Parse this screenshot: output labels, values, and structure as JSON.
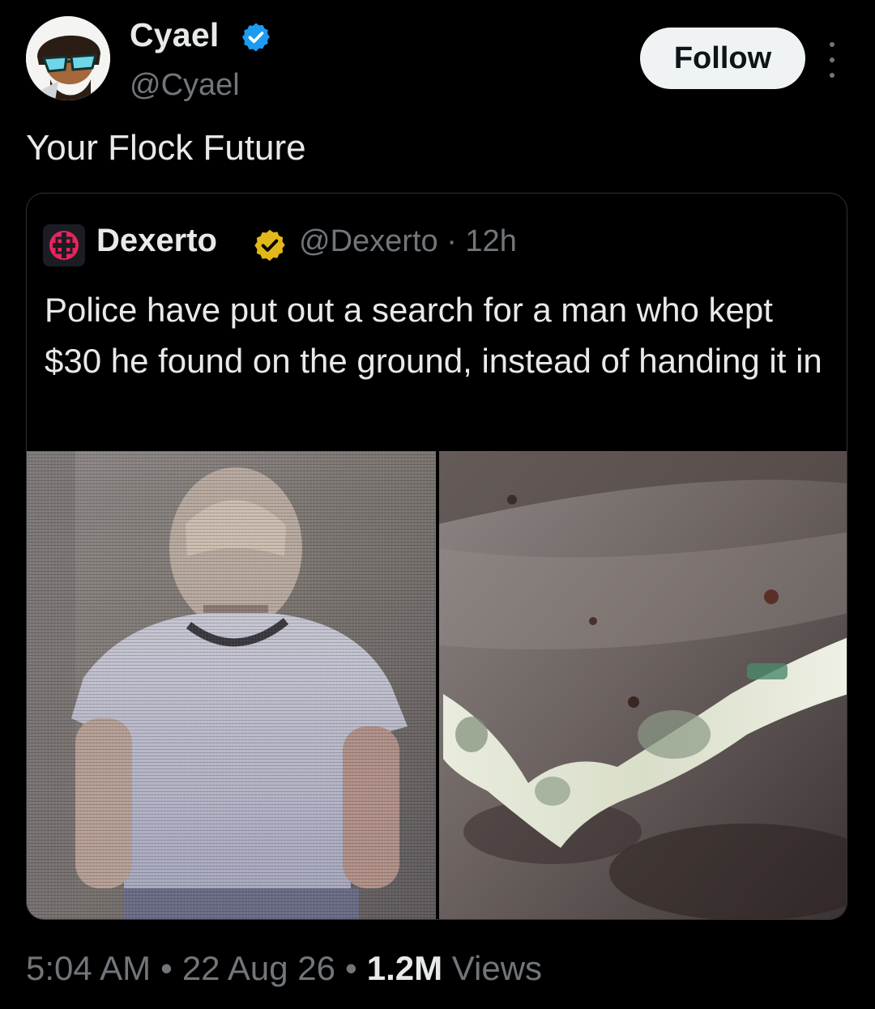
{
  "author": {
    "name": "Cyael",
    "handle": "@Cyael",
    "verified": true,
    "avatar_icon": "cartoon-man-sunglasses-avatar"
  },
  "actions": {
    "follow_label": "Follow",
    "more_icon": "vertical-ellipsis-icon"
  },
  "tweet": {
    "text": "Your Flock Future"
  },
  "quoted": {
    "name": "Dexerto",
    "handle": "@Dexerto",
    "separator": "·",
    "time": "12h",
    "verified": "gold",
    "avatar_icon": "dexerto-logo",
    "text": "Police have put out a search for a man who kept $30 he found on the ground, instead of handing it in",
    "media": [
      {
        "name": "cctv-man-photo"
      },
      {
        "name": "dollar-bill-on-wet-ground-photo"
      }
    ]
  },
  "footer": {
    "time": "5:04 AM",
    "date": "22 Aug 26",
    "views_count": "1.2M",
    "views_label": "Views",
    "separator": "•"
  },
  "colors": {
    "background": "#000000",
    "primary_text": "#e7e9ea",
    "secondary_text": "#71767b",
    "verified_blue": "#1d9bf0",
    "verified_gold": "#e2b719",
    "border": "#2f3336",
    "follow_bg": "#eff3f4"
  }
}
